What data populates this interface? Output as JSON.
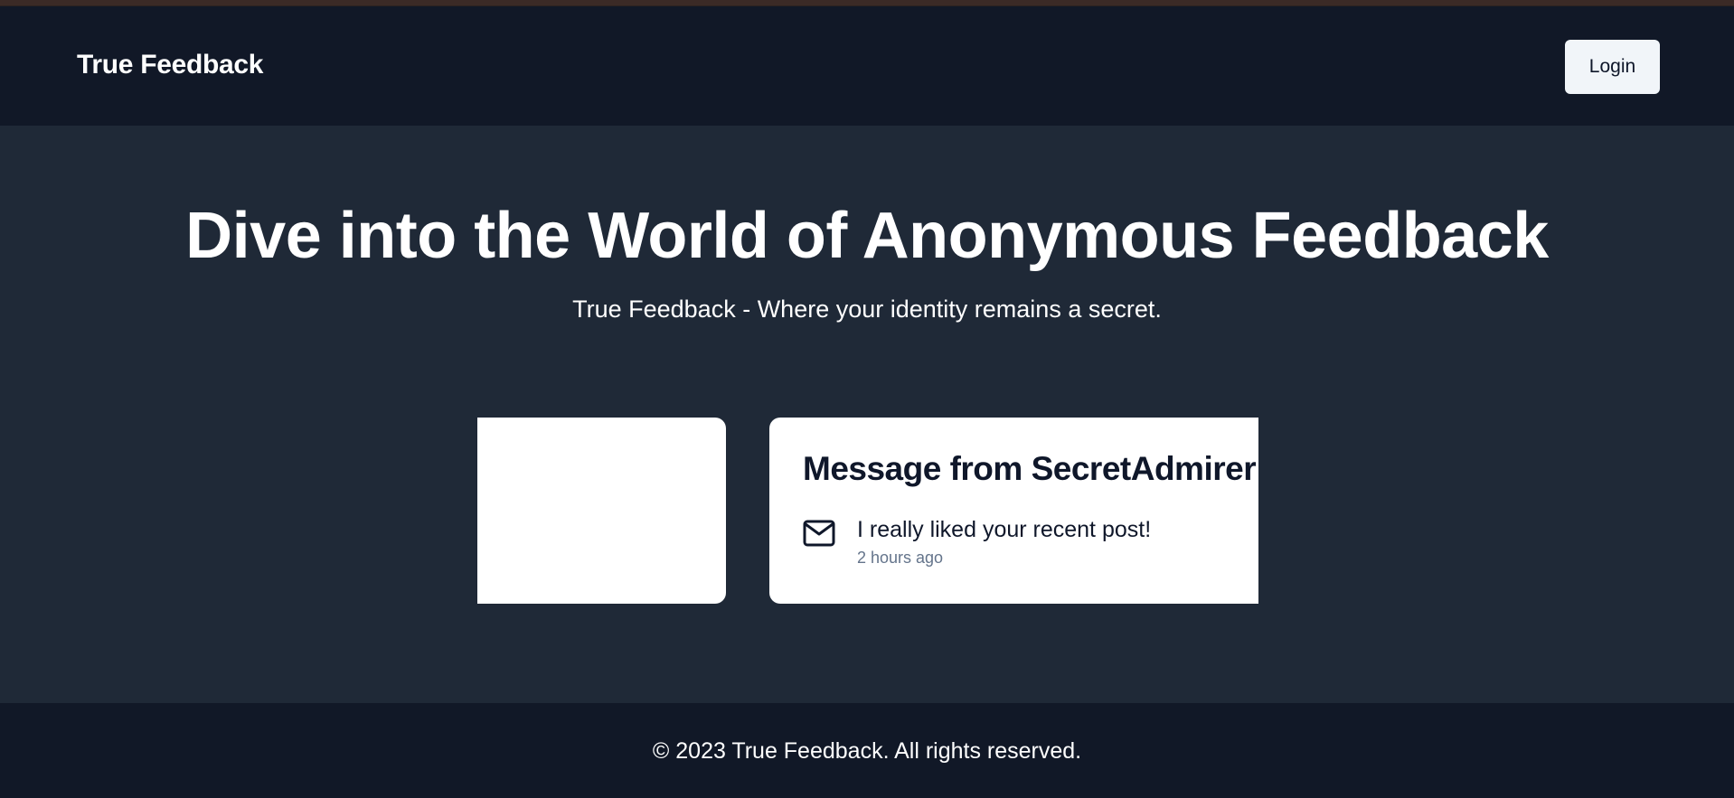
{
  "header": {
    "brand": "True Feedback",
    "login_label": "Login"
  },
  "hero": {
    "title": "Dive into the World of Anonymous Feedback",
    "subtitle": "True Feedback - Where your identity remains a secret."
  },
  "carousel": {
    "cards": [
      {
        "title": "Message from SecretAdmirer",
        "icon": "mail-icon",
        "message": "I really liked your recent post!",
        "time": "2 hours ago"
      }
    ]
  },
  "footer": {
    "text": "© 2023 True Feedback. All rights reserved."
  },
  "colors": {
    "nav_bg": "#111827",
    "main_bg": "#1f2937",
    "card_bg": "#ffffff",
    "button_bg": "#f1f5f9",
    "muted_text": "#64748b"
  }
}
